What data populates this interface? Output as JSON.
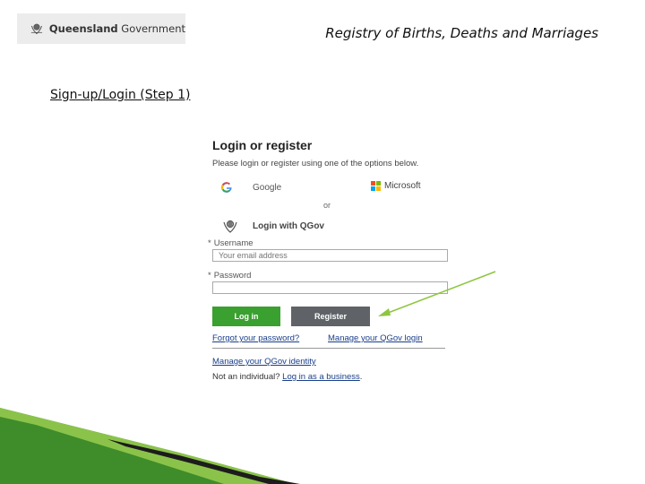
{
  "header": {
    "logo_bold": "Queensland",
    "logo_regular": " Government",
    "registry_title": "Registry of Births, Deaths and Marriages"
  },
  "step_label": "Sign-up/Login (Step 1)",
  "login": {
    "title": "Login or register",
    "subtitle": "Please login or register using one of the options below.",
    "google_label": "Google",
    "microsoft_label": "Microsoft",
    "or_label": "or",
    "qgov_label": "Login with QGov",
    "username_label": "Username",
    "username_placeholder": "Your email address",
    "password_label": "Password",
    "password_value": "",
    "required_mark": "*",
    "login_button": "Log in",
    "register_button": "Register",
    "forgot_password": "Forgot your password?",
    "manage_login": "Manage your QGov login",
    "manage_identity": "Manage your QGov identity",
    "not_individual": "Not an individual?",
    "business_login": "Log in as a business",
    "period": "."
  },
  "colors": {
    "login_button": "#3aa02f",
    "register_button": "#5f6367",
    "arrow": "#8dc63f",
    "link": "#1a3f8a"
  },
  "icons": {
    "crest": "qld-crest-icon",
    "google": "google-icon",
    "microsoft": "microsoft-icon",
    "qgov": "qgov-crest-icon",
    "arrow": "arrow-icon"
  }
}
